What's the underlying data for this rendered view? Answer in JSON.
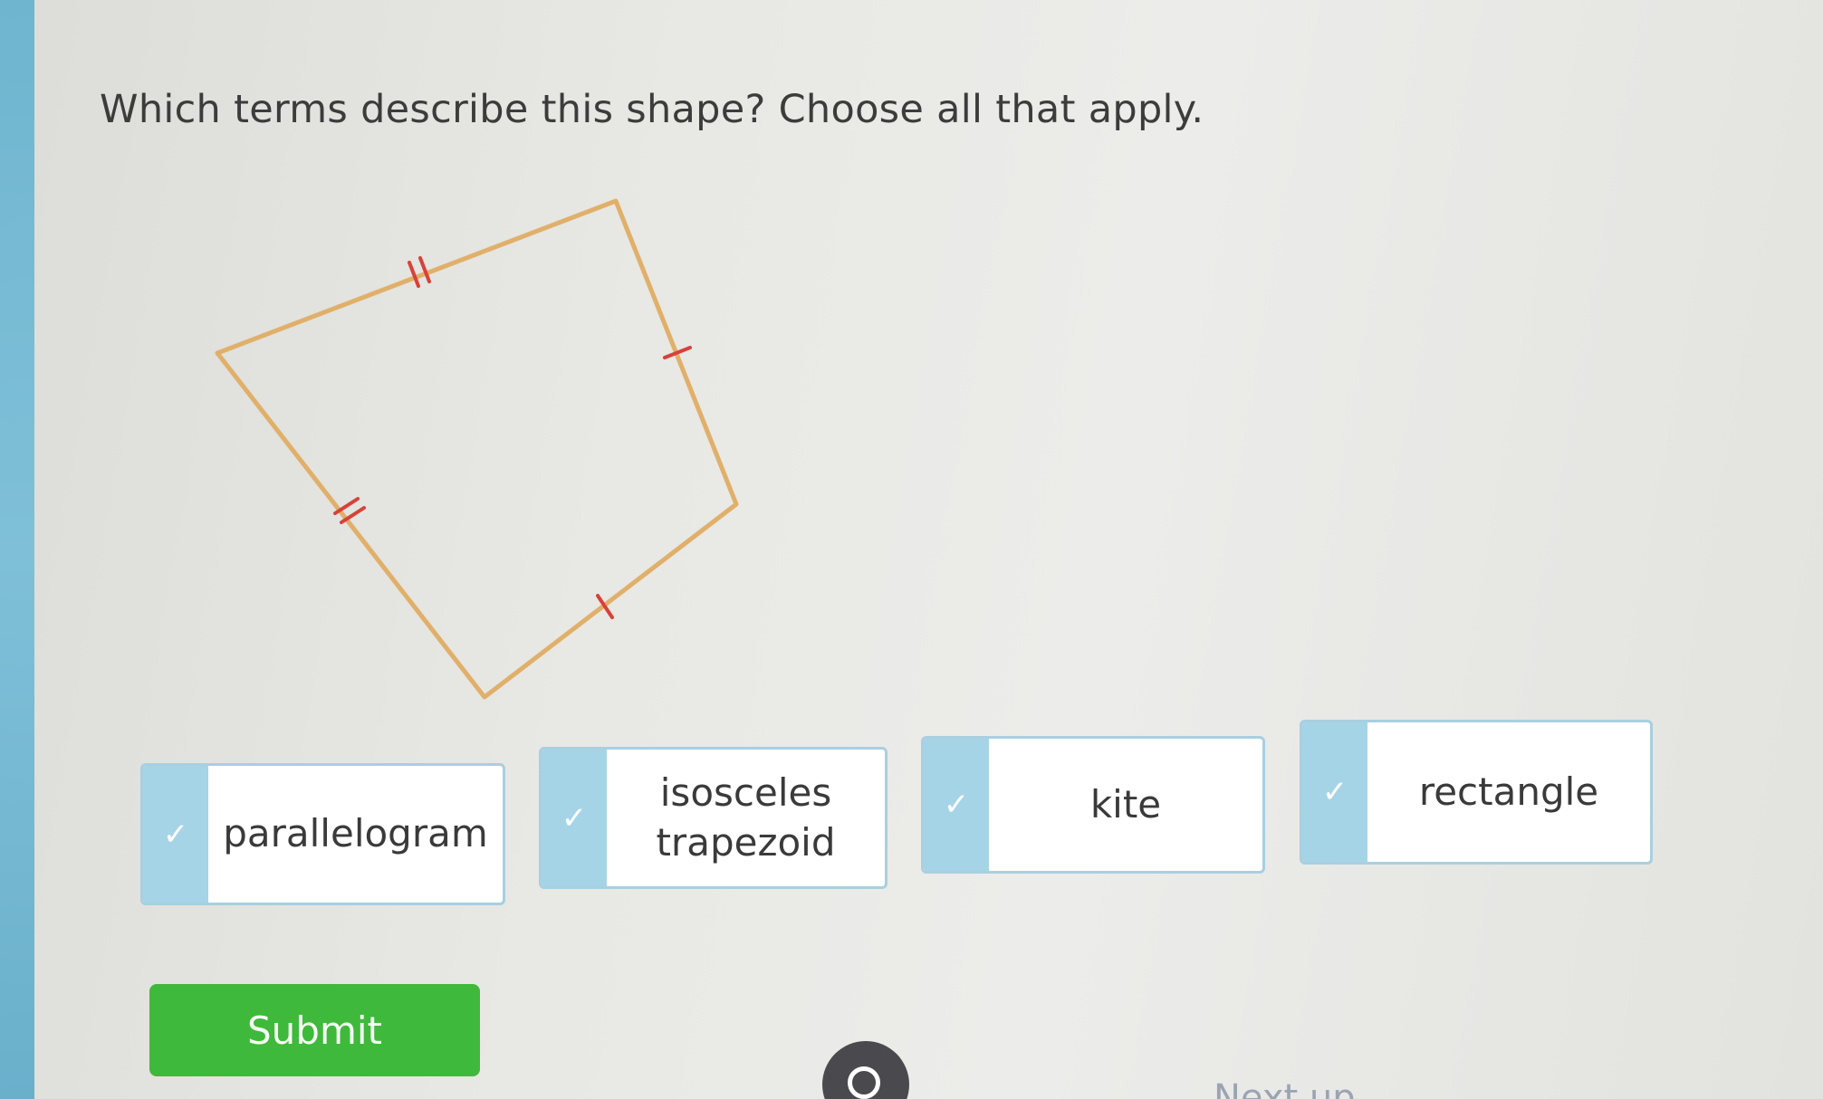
{
  "question": {
    "text": "Which terms describe this shape? Choose all that apply."
  },
  "shape": {
    "stroke_color": "#e0b06a",
    "tick_color": "#d8413a",
    "description_icon": "kite-shape-icon"
  },
  "choices": [
    {
      "id": "parallelogram",
      "label": "parallelogram",
      "selected": false
    },
    {
      "id": "isosceles-trapezoid",
      "label_line1": "isosceles",
      "label_line2": "trapezoid",
      "selected": false
    },
    {
      "id": "kite",
      "label": "kite",
      "selected": false
    },
    {
      "id": "rectangle",
      "label": "rectangle",
      "selected": false
    }
  ],
  "submit": {
    "label": "Submit",
    "color": "#3fb93b"
  },
  "footer": {
    "next_up_label": "Next up"
  },
  "colors": {
    "accent_blue": "#a6d4e7",
    "sidebar_blue": "#7fc0d8",
    "text": "#3c3c3c"
  }
}
